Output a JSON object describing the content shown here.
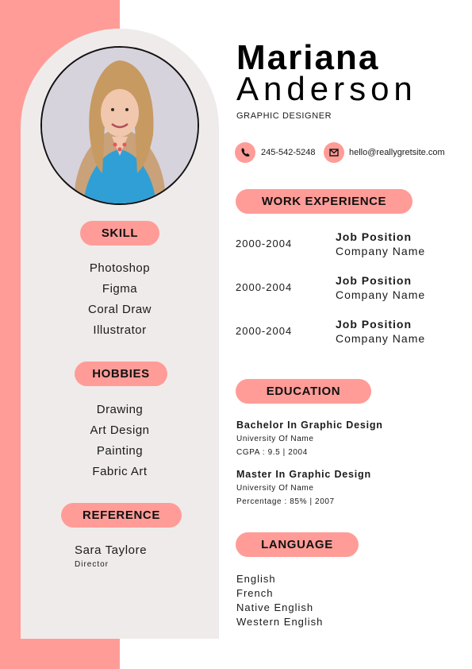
{
  "header": {
    "first_name": "Mariana",
    "last_name": "Anderson",
    "title": "GRAPHIC DESIGNER"
  },
  "contact": {
    "phone": "245-542-5248",
    "email": "hello@reallygretsite.com"
  },
  "sidebar": {
    "skill": {
      "heading": "SKILL",
      "items": [
        "Photoshop",
        "Figma",
        "Coral Draw",
        "Illustrator"
      ]
    },
    "hobbies": {
      "heading": "HOBBIES",
      "items": [
        "Drawing",
        "Art Design",
        "Painting",
        "Fabric Art"
      ]
    },
    "reference": {
      "heading": "REFERENCE",
      "name": "Sara Taylore",
      "role": "Director"
    }
  },
  "work": {
    "heading": "WORK EXPERIENCE",
    "items": [
      {
        "years": "2000-2004",
        "position": "Job Position",
        "company": "Company Name"
      },
      {
        "years": "2000-2004",
        "position": "Job Position",
        "company": "Company Name"
      },
      {
        "years": "2000-2004",
        "position": "Job Position",
        "company": "Company Name"
      }
    ]
  },
  "education": {
    "heading": "EDUCATION",
    "items": [
      {
        "degree": "Bachelor In Graphic Design",
        "school": "University Of Name",
        "detail": "CGPA : 9.5 | 2004"
      },
      {
        "degree": "Master In Graphic Design",
        "school": "University Of Name",
        "detail": "Percentage : 85% | 2007"
      }
    ]
  },
  "language": {
    "heading": "LANGUAGE",
    "items": [
      "English",
      "French",
      "Native English",
      "Western English"
    ]
  },
  "icons": {
    "phone": "phone-icon",
    "email": "envelope-icon"
  },
  "colors": {
    "accent": "#ff9c97",
    "panel": "#efebea"
  }
}
